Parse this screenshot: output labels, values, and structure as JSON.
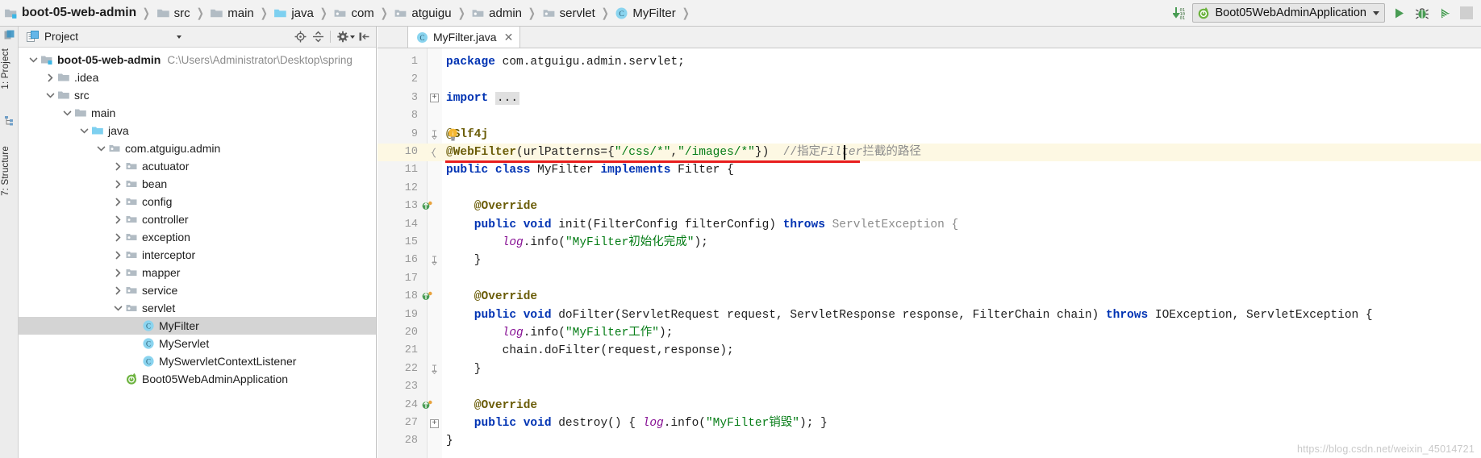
{
  "toolbar": {
    "breadcrumbs": [
      {
        "label": "boot-05-web-admin",
        "icon": "module-folder-icon",
        "root": true
      },
      {
        "label": "src",
        "icon": "folder-icon"
      },
      {
        "label": "main",
        "icon": "folder-icon"
      },
      {
        "label": "java",
        "icon": "source-folder-icon"
      },
      {
        "label": "com",
        "icon": "package-icon"
      },
      {
        "label": "atguigu",
        "icon": "package-icon"
      },
      {
        "label": "admin",
        "icon": "package-icon"
      },
      {
        "label": "servlet",
        "icon": "package-icon"
      },
      {
        "label": "MyFilter",
        "icon": "java-class-icon"
      }
    ],
    "separator": "❯",
    "update_icon": "download-updates-icon",
    "run_config": {
      "label": "Boot05WebAdminApplication",
      "icon": "spring-boot-icon",
      "dropdown_icon": "chevron-down-icon"
    },
    "run_button": "run-icon",
    "debug_button": "debug-icon",
    "coverage_button": "run-with-coverage-icon"
  },
  "left_strip": {
    "project_tab": "1: Project",
    "structure_tab": "7: Structure"
  },
  "project_panel": {
    "title": "Project",
    "title_icon": "project-view-icon",
    "dropdown_icon": "chevron-down-icon",
    "buttons": [
      {
        "name": "locate-icon",
        "label": "Select Opened File"
      },
      {
        "name": "collapse-all-icon",
        "label": "Collapse All"
      },
      {
        "name": "gear-icon",
        "label": "Settings"
      },
      {
        "name": "hide-panel-icon",
        "label": "Hide"
      }
    ],
    "tree": [
      {
        "label": "boot-05-web-admin",
        "path": "C:\\Users\\Administrator\\Desktop\\spring",
        "depth": 0,
        "twist": "expanded",
        "icon": "module-folder-icon",
        "bold": true,
        "selected": false
      },
      {
        "label": ".idea",
        "path": "",
        "depth": 1,
        "twist": "collapsed",
        "icon": "folder-icon",
        "bold": false,
        "selected": false
      },
      {
        "label": "src",
        "path": "",
        "depth": 1,
        "twist": "expanded",
        "icon": "folder-icon",
        "bold": false,
        "selected": false
      },
      {
        "label": "main",
        "path": "",
        "depth": 2,
        "twist": "expanded",
        "icon": "folder-icon",
        "bold": false,
        "selected": false
      },
      {
        "label": "java",
        "path": "",
        "depth": 3,
        "twist": "expanded",
        "icon": "source-folder-icon",
        "bold": false,
        "selected": false
      },
      {
        "label": "com.atguigu.admin",
        "path": "",
        "depth": 4,
        "twist": "expanded",
        "icon": "package-icon",
        "bold": false,
        "selected": false
      },
      {
        "label": "acutuator",
        "path": "",
        "depth": 5,
        "twist": "collapsed",
        "icon": "package-icon",
        "bold": false,
        "selected": false
      },
      {
        "label": "bean",
        "path": "",
        "depth": 5,
        "twist": "collapsed",
        "icon": "package-icon",
        "bold": false,
        "selected": false
      },
      {
        "label": "config",
        "path": "",
        "depth": 5,
        "twist": "collapsed",
        "icon": "package-icon",
        "bold": false,
        "selected": false
      },
      {
        "label": "controller",
        "path": "",
        "depth": 5,
        "twist": "collapsed",
        "icon": "package-icon",
        "bold": false,
        "selected": false
      },
      {
        "label": "exception",
        "path": "",
        "depth": 5,
        "twist": "collapsed",
        "icon": "package-icon",
        "bold": false,
        "selected": false
      },
      {
        "label": "interceptor",
        "path": "",
        "depth": 5,
        "twist": "collapsed",
        "icon": "package-icon",
        "bold": false,
        "selected": false
      },
      {
        "label": "mapper",
        "path": "",
        "depth": 5,
        "twist": "collapsed",
        "icon": "package-icon",
        "bold": false,
        "selected": false
      },
      {
        "label": "service",
        "path": "",
        "depth": 5,
        "twist": "collapsed",
        "icon": "package-icon",
        "bold": false,
        "selected": false
      },
      {
        "label": "servlet",
        "path": "",
        "depth": 5,
        "twist": "expanded",
        "icon": "package-icon",
        "bold": false,
        "selected": false
      },
      {
        "label": "MyFilter",
        "path": "",
        "depth": 6,
        "twist": "none",
        "icon": "java-class-icon",
        "bold": false,
        "selected": true
      },
      {
        "label": "MyServlet",
        "path": "",
        "depth": 6,
        "twist": "none",
        "icon": "java-class-icon",
        "bold": false,
        "selected": false
      },
      {
        "label": "MySwervletContextListener",
        "path": "",
        "depth": 6,
        "twist": "none",
        "icon": "java-class-icon",
        "bold": false,
        "selected": false
      },
      {
        "label": "Boot05WebAdminApplication",
        "path": "",
        "depth": 5,
        "twist": "none",
        "icon": "spring-class-icon",
        "bold": false,
        "selected": false
      }
    ]
  },
  "editor": {
    "tab": {
      "label": "MyFilter.java",
      "icon": "java-class-icon",
      "close_icon": "close-icon"
    },
    "lines": [
      {
        "num": "1",
        "tokens": [
          {
            "t": "package ",
            "c": "kw"
          },
          {
            "t": "com.atguigu.admin.servlet;",
            "c": "plain"
          }
        ]
      },
      {
        "num": "2",
        "tokens": []
      },
      {
        "num": "3",
        "tokens": [
          {
            "t": "import ",
            "c": "kw"
          },
          {
            "t": "...",
            "c": "fold-placeholder"
          }
        ],
        "fold": "plus"
      },
      {
        "num": "8",
        "tokens": []
      },
      {
        "num": "9",
        "tokens": [
          {
            "t": "@Slf4j",
            "c": "annb"
          }
        ],
        "fold": "end",
        "bulb": true
      },
      {
        "num": "10",
        "tokens": [
          {
            "t": "@WebFilter",
            "c": "annb"
          },
          {
            "t": "(urlPatterns={",
            "c": "plain"
          },
          {
            "t": "\"/css/*\"",
            "c": "str"
          },
          {
            "t": ",",
            "c": "plain"
          },
          {
            "t": "\"/images/*\"",
            "c": "str"
          },
          {
            "t": "})  ",
            "c": "plain"
          },
          {
            "t": "//指定",
            "c": "cmt"
          },
          {
            "t": "Filter",
            "c": "cmt-i"
          },
          {
            "t": "拦截的路径",
            "c": "cmt"
          }
        ],
        "highlight": true,
        "fold": "brace",
        "caret": true,
        "underline": true
      },
      {
        "num": "11",
        "tokens": [
          {
            "t": "public class ",
            "c": "kw"
          },
          {
            "t": "MyFilter ",
            "c": "plain"
          },
          {
            "t": "implements ",
            "c": "kw"
          },
          {
            "t": "Filter {",
            "c": "plain"
          }
        ]
      },
      {
        "num": "12",
        "tokens": []
      },
      {
        "num": "13",
        "tokens": [
          {
            "t": "    @Override",
            "c": "annb"
          }
        ],
        "gutter": "run-override"
      },
      {
        "num": "14",
        "tokens": [
          {
            "t": "    public void ",
            "c": "kw"
          },
          {
            "t": "init(FilterConfig filterConfig) ",
            "c": "plain"
          },
          {
            "t": "throws ",
            "c": "kw"
          },
          {
            "t": "ServletException {",
            "c": "typ-gray"
          }
        ]
      },
      {
        "num": "15",
        "tokens": [
          {
            "t": "        ",
            "c": "plain"
          },
          {
            "t": "log",
            "c": "fld"
          },
          {
            "t": ".info(",
            "c": "plain"
          },
          {
            "t": "\"MyFilter初始化完成\"",
            "c": "str"
          },
          {
            "t": ");",
            "c": "plain"
          }
        ]
      },
      {
        "num": "16",
        "tokens": [
          {
            "t": "    }",
            "c": "plain"
          }
        ],
        "fold": "end"
      },
      {
        "num": "17",
        "tokens": []
      },
      {
        "num": "18",
        "tokens": [
          {
            "t": "    @Override",
            "c": "annb"
          }
        ],
        "gutter": "run-override"
      },
      {
        "num": "19",
        "tokens": [
          {
            "t": "    public void ",
            "c": "kw"
          },
          {
            "t": "doFilter(ServletRequest request, ServletResponse response, FilterChain chain) ",
            "c": "plain"
          },
          {
            "t": "throws ",
            "c": "kw"
          },
          {
            "t": "IOException, ServletException {",
            "c": "plain"
          }
        ]
      },
      {
        "num": "20",
        "tokens": [
          {
            "t": "        ",
            "c": "plain"
          },
          {
            "t": "log",
            "c": "fld"
          },
          {
            "t": ".info(",
            "c": "plain"
          },
          {
            "t": "\"MyFilter工作\"",
            "c": "str"
          },
          {
            "t": ");",
            "c": "plain"
          }
        ]
      },
      {
        "num": "21",
        "tokens": [
          {
            "t": "        chain.doFilter(request,response);",
            "c": "plain"
          }
        ]
      },
      {
        "num": "22",
        "tokens": [
          {
            "t": "    }",
            "c": "plain"
          }
        ],
        "fold": "end"
      },
      {
        "num": "23",
        "tokens": []
      },
      {
        "num": "24",
        "tokens": [
          {
            "t": "    @Override",
            "c": "annb"
          }
        ],
        "gutter": "run-override"
      },
      {
        "num": "27",
        "tokens": [
          {
            "t": "    public void ",
            "c": "kw"
          },
          {
            "t": "destroy() { ",
            "c": "plain"
          },
          {
            "t": "log",
            "c": "fld"
          },
          {
            "t": ".info(",
            "c": "plain"
          },
          {
            "t": "\"MyFilter销毁\"",
            "c": "str"
          },
          {
            "t": "); }",
            "c": "plain"
          }
        ],
        "fold": "plus"
      },
      {
        "num": "28",
        "tokens": [
          {
            "t": "}",
            "c": "plain"
          }
        ]
      }
    ]
  },
  "watermark": "https://blog.csdn.net/weixin_45014721",
  "colors": {
    "accent_blue": "#3592c4",
    "keyword": "#0033b3",
    "string": "#067d17",
    "annotation": "#9e880d",
    "comment": "#8c8c8c",
    "highlight_line": "#fdf8e3",
    "error_underline": "#e81e1e",
    "selection": "#d4d4d4",
    "run_green": "#499c54"
  }
}
